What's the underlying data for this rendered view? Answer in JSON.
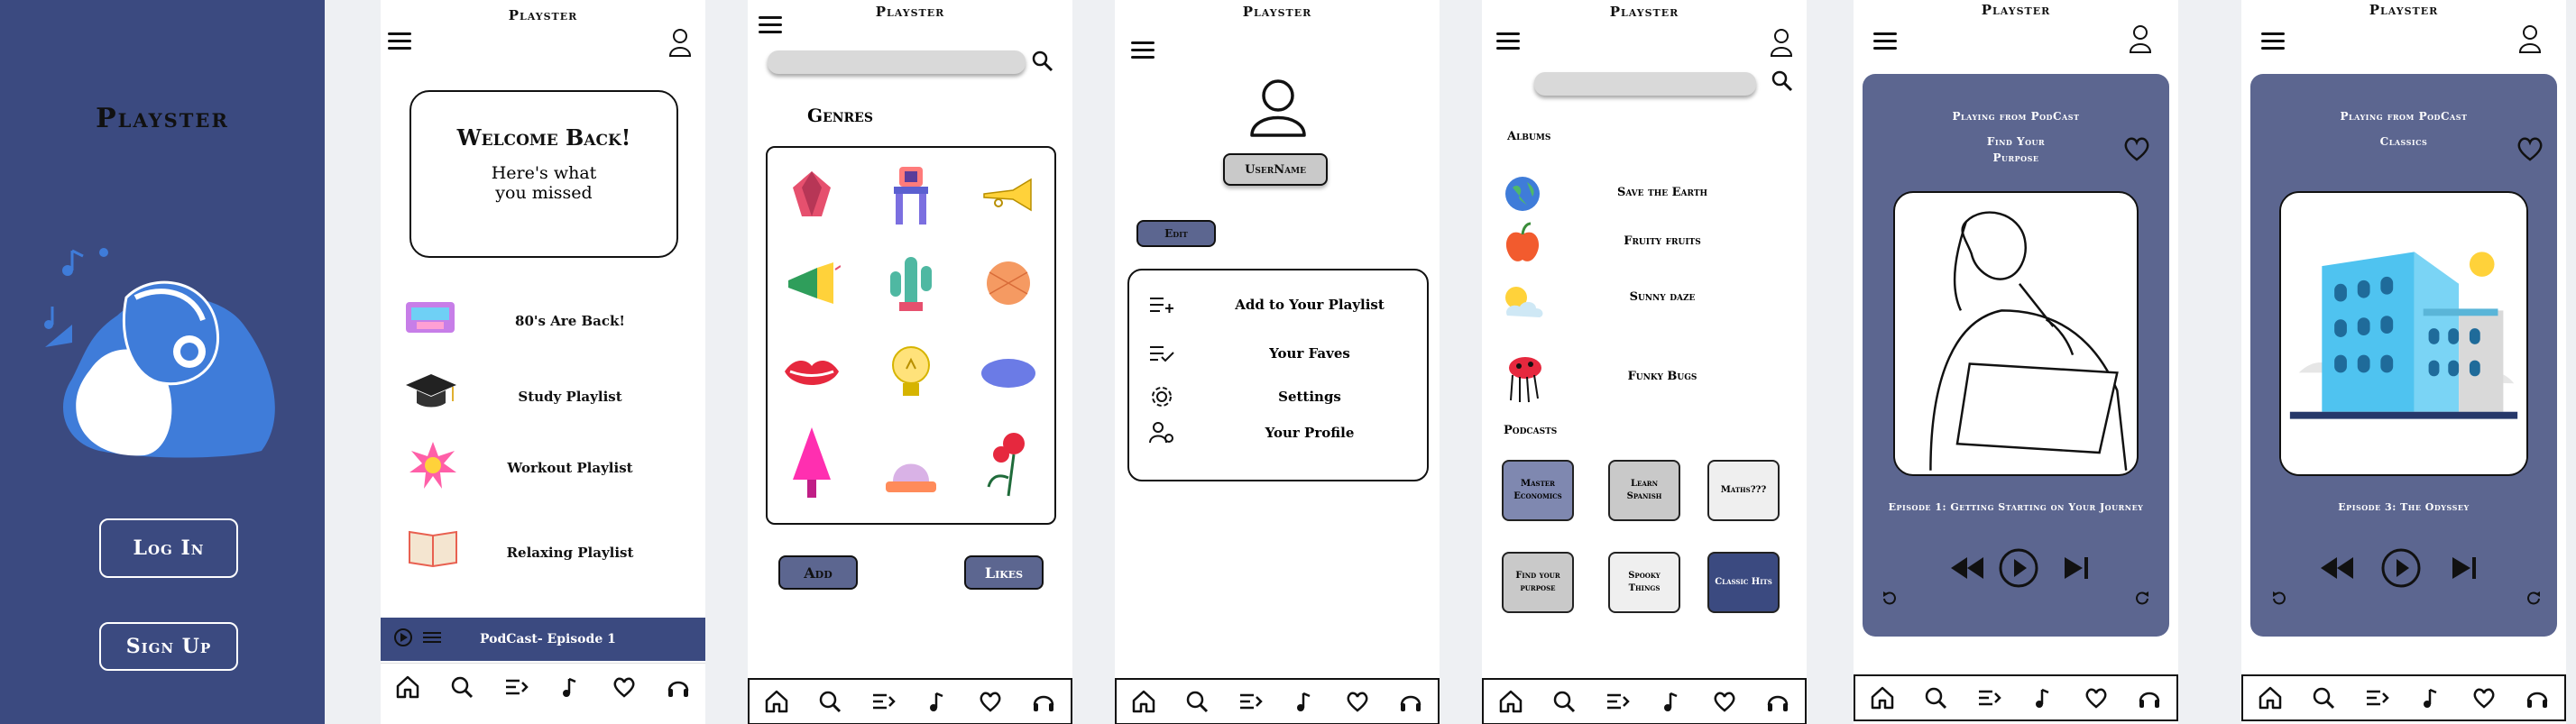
{
  "app": {
    "name": "Playster"
  },
  "splash": {
    "login_label": "Log In",
    "signup_label": "Sign Up"
  },
  "home": {
    "welcome_title": "Welcome Back!",
    "welcome_sub_1": "Here's what",
    "welcome_sub_2": "you missed",
    "playlists": [
      {
        "label": "80's Are Back!",
        "icon": "cassette-tape-icon"
      },
      {
        "label": "Study Playlist",
        "icon": "graduation-cap-icon"
      },
      {
        "label": "Workout Playlist",
        "icon": "starburst-icon"
      },
      {
        "label": "Relaxing Playlist",
        "icon": "open-book-icon"
      }
    ],
    "now_playing": "PodCast- Episode 1"
  },
  "genres": {
    "title": "Genres",
    "items": [
      "gem-icon",
      "radio-tower-icon",
      "trumpet-icon",
      "megaphone-icon",
      "cactus-icon",
      "basketball-icon",
      "lips-icon",
      "lightbulb-icon",
      "blue-oval-icon",
      "pink-tree-icon",
      "dome-icon",
      "poppy-flower-icon"
    ],
    "add_label": "Add",
    "likes_label": "Likes"
  },
  "profile": {
    "username_label": "UserName",
    "edit_label": "Edit",
    "menu": [
      {
        "label": "Add to Your Playlist",
        "icon": "add-to-list-icon"
      },
      {
        "label": "Your Faves",
        "icon": "list-check-icon"
      },
      {
        "label": "Settings",
        "icon": "gear-icon"
      },
      {
        "label": "Your Profile",
        "icon": "user-settings-icon"
      }
    ]
  },
  "browse": {
    "albums_title": "Albums",
    "albums": [
      {
        "label": "Save the Earth",
        "icon": "globe-icon"
      },
      {
        "label": "Fruity fruits",
        "icon": "apple-icon"
      },
      {
        "label": "Sunny daze",
        "icon": "sun-cloud-icon"
      },
      {
        "label": "Funky Bugs",
        "icon": "bug-icon"
      }
    ],
    "podcasts_title": "Podcasts",
    "podcasts": [
      {
        "label": "Master Economics",
        "bg": "#7f88b0"
      },
      {
        "label": "Learn Spanish",
        "bg": "#c9c9c9"
      },
      {
        "label": "Maths???",
        "bg": "#efefef"
      },
      {
        "label": "Find your purpose",
        "bg": "#c9c9c9"
      },
      {
        "label": "Spooky Things",
        "bg": "#efefef"
      },
      {
        "label": "Classic Hits",
        "bg": "#3b4a80"
      }
    ]
  },
  "player1": {
    "playing_from": "Playing from PodCast",
    "show_line1": "Find Your",
    "show_line2": "Purpose",
    "episode": "Episode 1: Getting Starting on Your Journey"
  },
  "player2": {
    "playing_from": "Playing from PodCast",
    "show_line1": "Classics",
    "episode": "Episode 3: The Odyssey"
  },
  "colors": {
    "brand": "#3b4a80",
    "player_bg": "#5c6690",
    "button_blue": "#5c6690",
    "light_button": "#c9c9c9"
  }
}
